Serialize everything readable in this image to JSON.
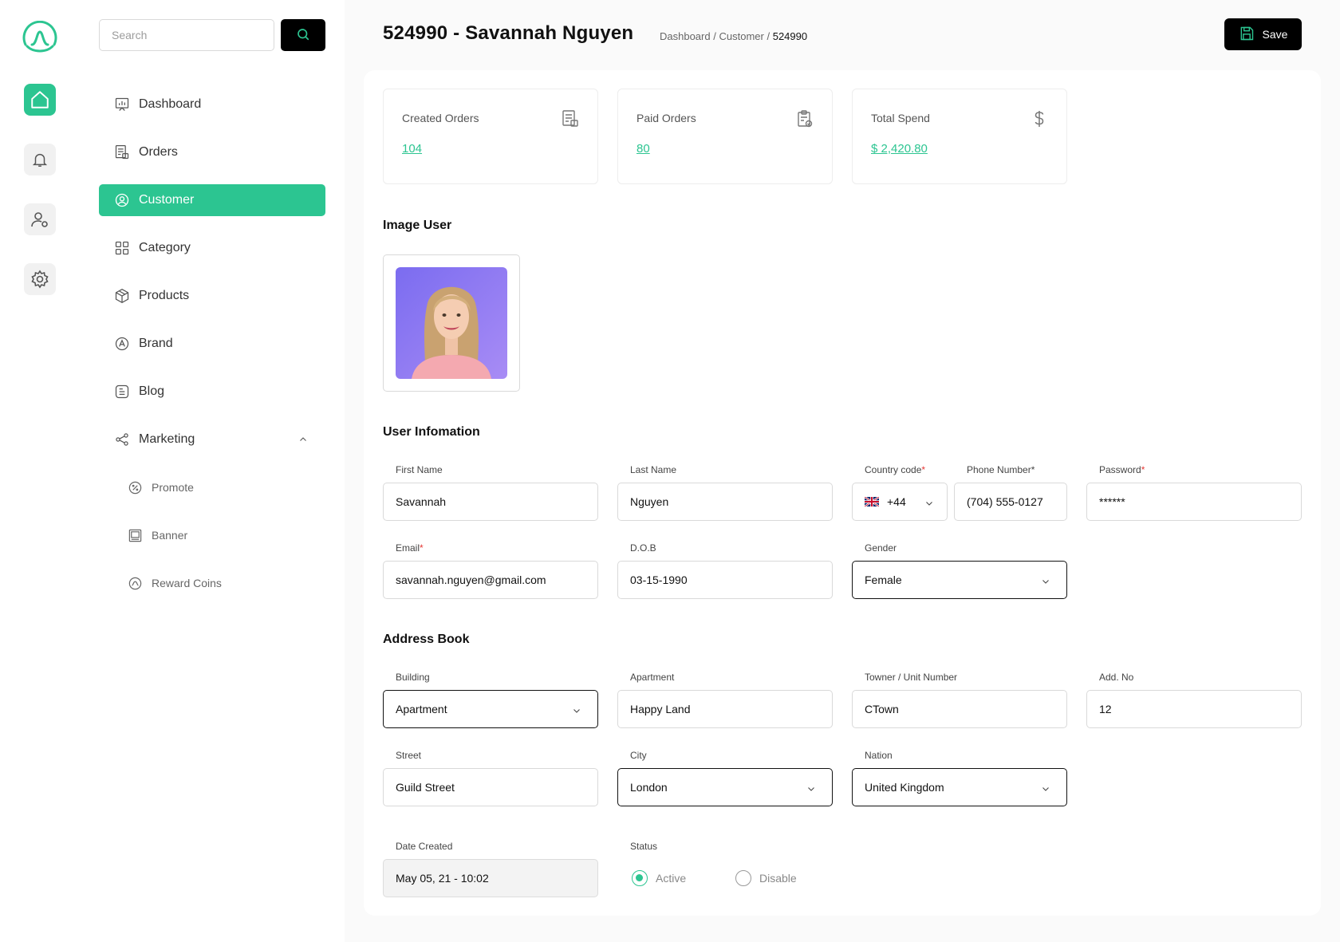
{
  "search": {
    "placeholder": "Search"
  },
  "sidebar": {
    "items": [
      {
        "label": "Dashboard",
        "icon": "chart-board-icon"
      },
      {
        "label": "Orders",
        "icon": "orders-icon"
      },
      {
        "label": "Customer",
        "icon": "user-circle-icon",
        "active": true
      },
      {
        "label": "Category",
        "icon": "grid-icon"
      },
      {
        "label": "Products",
        "icon": "box-icon"
      },
      {
        "label": "Brand",
        "icon": "brand-icon"
      },
      {
        "label": "Blog",
        "icon": "blog-icon"
      },
      {
        "label": "Marketing",
        "icon": "share-icon",
        "expanded": true
      }
    ],
    "subitems": [
      {
        "label": "Promote",
        "icon": "percent-icon"
      },
      {
        "label": "Banner",
        "icon": "banner-icon"
      },
      {
        "label": "Reward Coins",
        "icon": "coin-icon"
      }
    ]
  },
  "header": {
    "title": "524990 - Savannah Nguyen",
    "breadcrumb": [
      "Dashboard",
      "Customer",
      "524990"
    ],
    "save_label": "Save"
  },
  "stats": [
    {
      "label": "Created Orders",
      "value": "104",
      "icon": "orders-icon"
    },
    {
      "label": "Paid Orders",
      "value": "80",
      "icon": "clipboard-check-icon"
    },
    {
      "label": "Total Spend",
      "value": "$ 2,420.80",
      "icon": "dollar-icon"
    }
  ],
  "image_section": {
    "title": "Image User"
  },
  "user_info": {
    "title": "User Infomation",
    "first_name": {
      "label": "First Name",
      "value": "Savannah"
    },
    "last_name": {
      "label": "Last Name",
      "value": "Nguyen"
    },
    "country_code": {
      "label": "Country code",
      "value": "+44",
      "flag": "uk-flag-icon"
    },
    "phone": {
      "label": "Phone Number*",
      "value": "(704) 555-0127"
    },
    "password": {
      "label": "Password",
      "value": "******"
    },
    "email": {
      "label": "Email",
      "value": "savannah.nguyen@gmail.com"
    },
    "dob": {
      "label": "D.O.B",
      "value": "03-15-1990"
    },
    "gender": {
      "label": "Gender",
      "value": "Female"
    }
  },
  "address": {
    "title": "Address Book",
    "building": {
      "label": "Building",
      "value": "Apartment"
    },
    "apartment": {
      "label": "Apartment",
      "value": "Happy Land"
    },
    "tower": {
      "label": "Towner / Unit Number",
      "value": "CTown"
    },
    "add_no": {
      "label": "Add. No",
      "value": "12"
    },
    "street": {
      "label": "Street",
      "value": "Guild Street"
    },
    "city": {
      "label": "City",
      "value": "London"
    },
    "nation": {
      "label": "Nation",
      "value": "United Kingdom"
    }
  },
  "meta": {
    "date_created": {
      "label": "Date Created",
      "value": "May 05, 21 - 10:02"
    },
    "status": {
      "label": "Status",
      "options": [
        "Active",
        "Disable"
      ],
      "selected": "Active"
    }
  },
  "colors": {
    "accent": "#2cc591",
    "dark": "#000000",
    "required": "#e53935"
  }
}
